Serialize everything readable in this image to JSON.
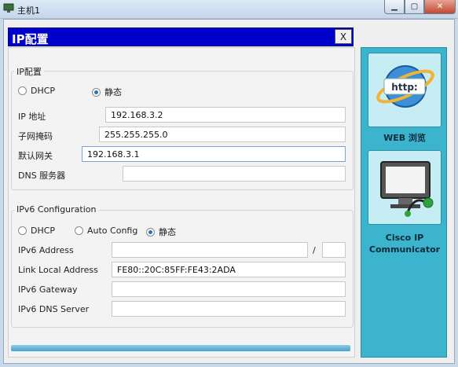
{
  "window": {
    "title": "主机1",
    "min_glyph": "▁",
    "max_glyph": "▢",
    "close_glyph": "✕"
  },
  "ip_panel": {
    "title": "IP配置",
    "close_label": "X",
    "ipv4": {
      "group_title": "IP配置",
      "dhcp_label": "DHCP",
      "static_label": "静态",
      "mode": "static",
      "ip_label": "IP 地址",
      "ip_value": "192.168.3.2",
      "mask_label": "子网掩码",
      "mask_value": "255.255.255.0",
      "gateway_label": "默认网关",
      "gateway_value": "192.168.3.1",
      "dns_label": "DNS 服务器",
      "dns_value": ""
    },
    "ipv6": {
      "group_title": "IPv6 Configuration",
      "dhcp_label": "DHCP",
      "auto_label": "Auto Config",
      "static_label": "静态",
      "mode": "static",
      "address_label": "IPv6 Address",
      "address_value": "",
      "prefix_sep": "/",
      "prefix_value": "",
      "link_local_label": "Link Local Address",
      "link_local_value": "FE80::20C:85FF:FE43:2ADA",
      "gateway_label": "IPv6 Gateway",
      "gateway_value": "",
      "dns_label": "IPv6 DNS Server",
      "dns_value": ""
    }
  },
  "sidebar": {
    "web_label": "WEB 浏览",
    "web_icon_text": "http:",
    "cisco_label_line1": "Cisco IP",
    "cisco_label_line2": "Communicator"
  },
  "colors": {
    "accent": "#0000cc",
    "sidebar": "#3db4cd"
  }
}
